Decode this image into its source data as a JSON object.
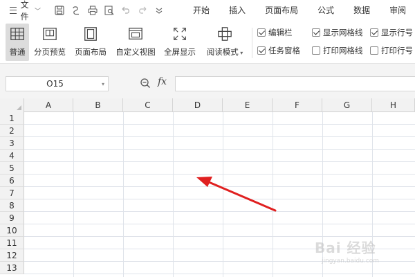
{
  "menubar": {
    "file_label": "文件",
    "tabs": [
      "开始",
      "插入",
      "页面布局",
      "公式",
      "数据",
      "审阅"
    ]
  },
  "quick_access": {
    "icons": [
      "save-icon",
      "undo-history-icon",
      "print-icon",
      "print-preview-icon",
      "undo-icon",
      "redo-icon",
      "customize-dropdown-icon"
    ]
  },
  "ribbon": {
    "views": [
      {
        "label": "普通",
        "icon": "normal-view-icon",
        "active": true
      },
      {
        "label": "分页预览",
        "icon": "page-break-preview-icon",
        "active": false
      },
      {
        "label": "页面布局",
        "icon": "page-layout-view-icon",
        "active": false
      },
      {
        "label": "自定义视图",
        "icon": "custom-view-icon",
        "active": false
      },
      {
        "label": "全屏显示",
        "icon": "fullscreen-icon",
        "active": false
      },
      {
        "label": "阅读模式",
        "icon": "reading-mode-icon",
        "active": false
      }
    ],
    "checkboxes": [
      {
        "label": "编辑栏",
        "checked": true
      },
      {
        "label": "任务窗格",
        "checked": true
      },
      {
        "label": "显示网格线",
        "checked": true
      },
      {
        "label": "打印网格线",
        "checked": false
      },
      {
        "label": "显示行号",
        "checked": true
      },
      {
        "label": "打印行号",
        "checked": false
      }
    ]
  },
  "formula_bar": {
    "cell_ref": "O15",
    "fx_label": "fx",
    "formula_value": ""
  },
  "sheet": {
    "columns": [
      "A",
      "B",
      "C",
      "D",
      "E",
      "F",
      "G",
      "H"
    ],
    "rows": [
      "1",
      "2",
      "3",
      "4",
      "5",
      "6",
      "7",
      "8",
      "9",
      "10",
      "11",
      "12",
      "13"
    ]
  },
  "annotation": {
    "arrow_color": "#e02020"
  },
  "watermark": {
    "text": "Bai 经验",
    "sub": "jingyan.baidu.com"
  },
  "colors": {
    "active_view_bg": "#dcdcdc",
    "header_bg": "#f2f2f2",
    "formula_bar_bg": "#f4f4f4"
  }
}
